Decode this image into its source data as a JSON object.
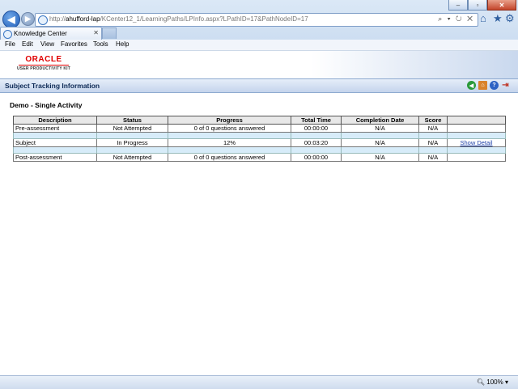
{
  "browser": {
    "url_prefix": "http://",
    "url_host": "ahufford-lap",
    "url_path": "/KCenter12_1/LearningPaths/LPInfo.aspx?LPathID=17&PathNodeID=17",
    "address_tools": "⌕ ▾ ↻ ✕",
    "tab_title": "Knowledge Center",
    "tab_close": "✕",
    "menu": [
      "File",
      "Edit",
      "View",
      "Favorites",
      "Tools",
      "Help"
    ],
    "zoom": "100%",
    "icons": [
      "back-icon",
      "forward-icon",
      "home-icon",
      "favorites-star-icon",
      "settings-gear-icon"
    ]
  },
  "branding": {
    "logo_text": "ORACLE",
    "logo_subtext": "USER PRODUCTIVITY KIT",
    "logo_color": "#e00000"
  },
  "page": {
    "section_title": "Subject Tracking Information",
    "course_title": "Demo - Single Activity",
    "toolbar_icons": [
      "go-back-icon",
      "home-icon",
      "help-icon",
      "exit-icon"
    ]
  },
  "table": {
    "headers": [
      "Description",
      "Status",
      "Progress",
      "Total Time",
      "Completion Date",
      "Score",
      ""
    ],
    "rows": [
      {
        "description": "Pre-assessment",
        "status": "Not Attempted",
        "progress": "0 of 0 questions answered",
        "total_time": "00:00:00",
        "completion_date": "N/A",
        "score": "N/A",
        "action": ""
      },
      {
        "description": "Subject",
        "status": "In Progress",
        "progress": "12%",
        "total_time": "00:03:20",
        "completion_date": "N/A",
        "score": "N/A",
        "action": "Show Detail"
      },
      {
        "description": "Post-assessment",
        "status": "Not Attempted",
        "progress": "0 of 0 questions answered",
        "total_time": "00:00:00",
        "completion_date": "N/A",
        "score": "N/A",
        "action": ""
      }
    ]
  }
}
